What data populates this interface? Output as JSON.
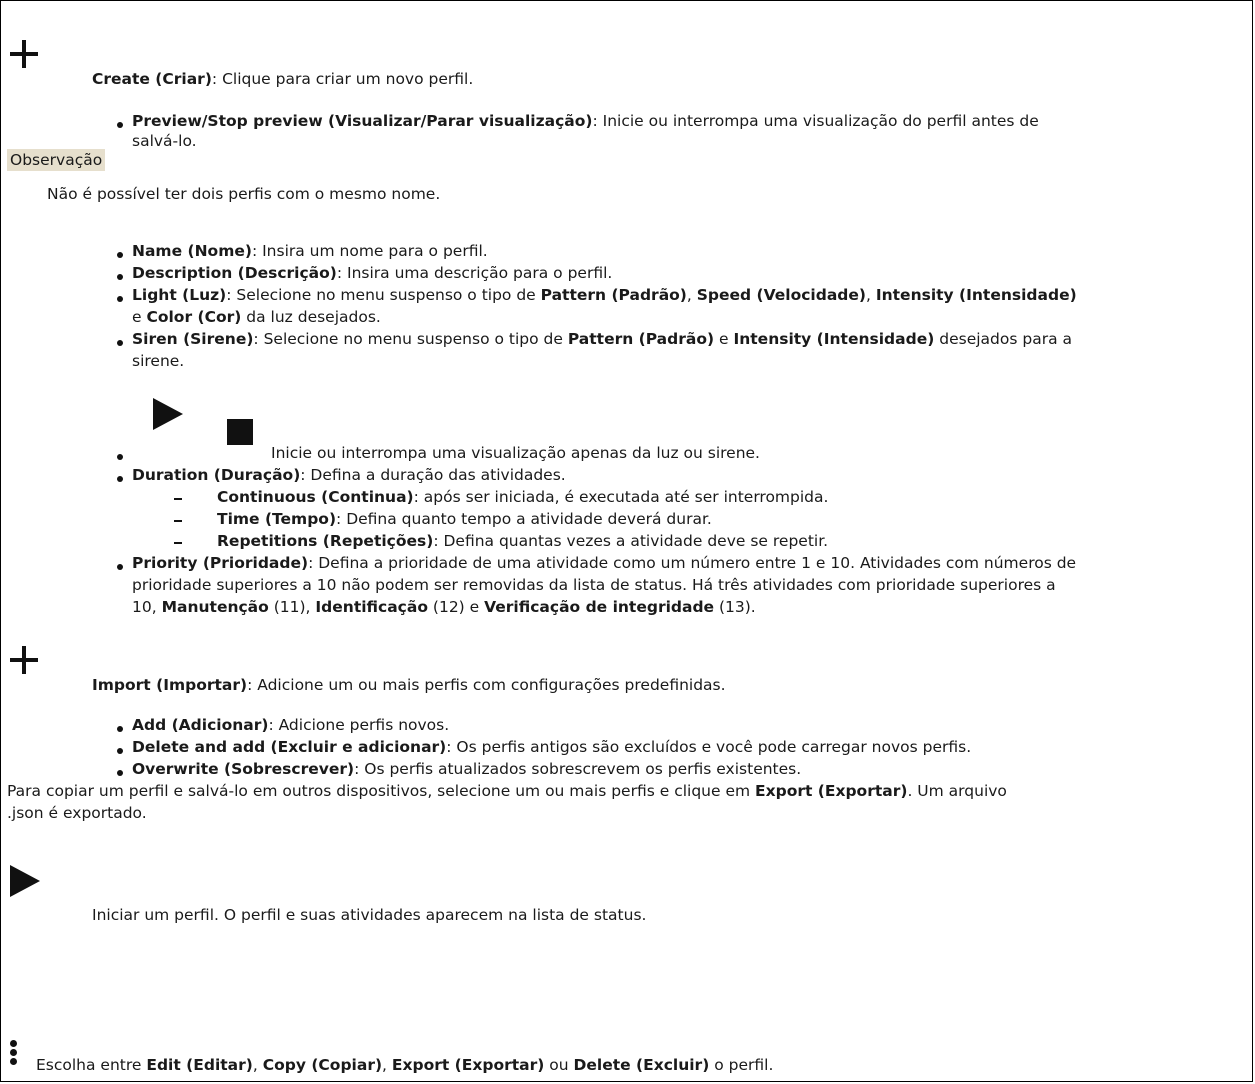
{
  "create": {
    "icon": "plus-icon",
    "label_bold": "Create (Criar)",
    "label_rest": ": Clique para criar um novo perfil.",
    "preview_bold": "Preview/Stop preview (Visualizar/Parar visualização)",
    "preview_rest_line1": ": Inicie ou interrompa uma visualização do perfil antes de",
    "preview_rest_line2": "salvá-lo."
  },
  "note": {
    "label": "Observação",
    "text": "Não é possível ter dois perfis com o mesmo nome."
  },
  "fields": {
    "name_bold": "Name (Nome)",
    "name_rest": ": Insira um nome para o perfil.",
    "description_bold": "Description (Descrição)",
    "description_rest": ": Insira uma descrição para o perfil.",
    "light_bold": "Light (Luz)",
    "light_rest1": ": Selecione no menu suspenso o tipo de ",
    "light_pattern": "Pattern (Padrão)",
    "comma1": ", ",
    "light_speed": "Speed (Velocidade)",
    "comma2": ", ",
    "light_intensity": "Intensity (Intensidade)",
    "light_e": "e ",
    "light_color": "Color (Cor)",
    "light_rest2": " da luz desejados.",
    "siren_bold": "Siren (Sirene)",
    "siren_rest1": ": Selecione no menu suspenso o tipo de ",
    "siren_pattern": "Pattern (Padrão)",
    "siren_e": " e ",
    "siren_intensity": "Intensity (Intensidade)",
    "siren_rest2": " desejados para a",
    "siren_rest3": "sirene.",
    "playstop_text": "Inicie ou interrompa uma visualização apenas da luz ou sirene.",
    "duration_bold": "Duration (Duração)",
    "duration_rest": ": Defina a duração das atividades.",
    "continuous_bold": "Continuous (Continua)",
    "continuous_rest": ": após ser iniciada, é executada até ser interrompida.",
    "time_bold": "Time (Tempo)",
    "time_rest": ": Defina quanto tempo a atividade deverá durar.",
    "repetitions_bold": "Repetitions (Repetições)",
    "repetitions_rest": ": Defina quantas vezes a atividade deve se repetir.",
    "priority_bold": "Priority (Prioridade)",
    "priority_line1": ": Defina a prioridade de uma atividade como um número entre 1 e 10. Atividades com números de",
    "priority_line2": "prioridade superiores a 10 não podem ser removidas da lista de status. Há três atividades com prioridade superiores a",
    "priority_line3_a": "10, ",
    "maintenance": "Manutenção",
    "p11": " (11), ",
    "identification": "Identificação",
    "p12": " (12) e ",
    "health": "Verificação de integridade",
    "p13": " (13)."
  },
  "import": {
    "icon": "plus-icon",
    "label_bold": "Import (Importar)",
    "label_rest": ": Adicione um ou mais perfis com configurações predefinidas.",
    "add_bold": "Add (Adicionar)",
    "add_rest": ": Adicione perfis novos.",
    "delete_add_bold": "Delete and add (Excluir e adicionar)",
    "delete_add_rest": ": Os perfis antigos são excluídos e você pode carregar novos perfis.",
    "overwrite_bold": "Overwrite (Sobrescrever)",
    "overwrite_rest": ": Os perfis atualizados sobrescrevem os perfis existentes."
  },
  "export": {
    "line1_a": "Para copiar um perfil e salvá-lo em outros dispositivos, selecione um ou mais perfis e clique em ",
    "export_bold": "Export (Exportar)",
    "line1_b": ". Um arquivo",
    "line2": ".json é exportado."
  },
  "start": {
    "icon": "play-icon",
    "text": "Iniciar um perfil. O perfil e suas atividades aparecem na lista de status."
  },
  "menu": {
    "icon": "more-vertical-icon",
    "a": "Escolha entre ",
    "edit": "Edit (Editar)",
    "c1": ", ",
    "copy": "Copy (Copiar)",
    "c2": ", ",
    "export": "Export (Exportar)",
    "ou": " ou ",
    "delete": "Delete (Excluir)",
    "end": " o perfil."
  }
}
